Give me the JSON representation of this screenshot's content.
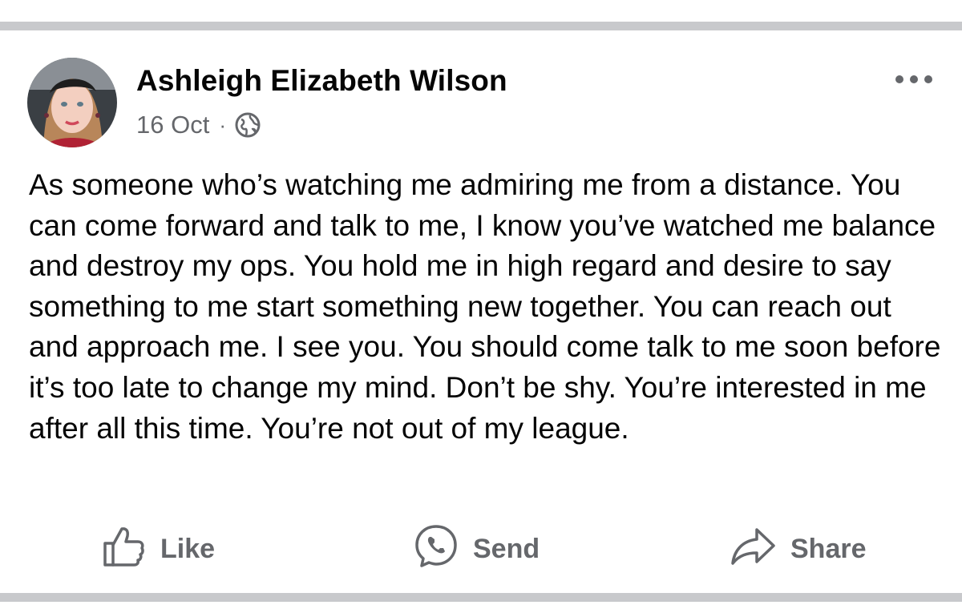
{
  "post": {
    "author": "Ashleigh Elizabeth Wilson",
    "timestamp": "16 Oct",
    "separator": "·",
    "privacy_icon": "globe-icon",
    "more_icon": "more-options-icon",
    "text": "As someone who’s watching me admiring me from a distance. You can come forward and talk to me, I know you’ve watched me balance and destroy my ops. You hold me in high regard and desire to say something to me start something new together. You can reach out and approach me. I see you. You should come talk to me soon before it’s too late to change my mind. Don’t be shy. You’re interested in me after all this time. You’re not out of my league."
  },
  "actions": {
    "like": {
      "label": "Like",
      "icon": "thumbs-up-icon"
    },
    "send": {
      "label": "Send",
      "icon": "messenger-icon"
    },
    "share": {
      "label": "Share",
      "icon": "share-arrow-icon"
    }
  },
  "colors": {
    "primary_text": "#050505",
    "secondary_text": "#65676b",
    "divider": "#c8c9cc"
  }
}
